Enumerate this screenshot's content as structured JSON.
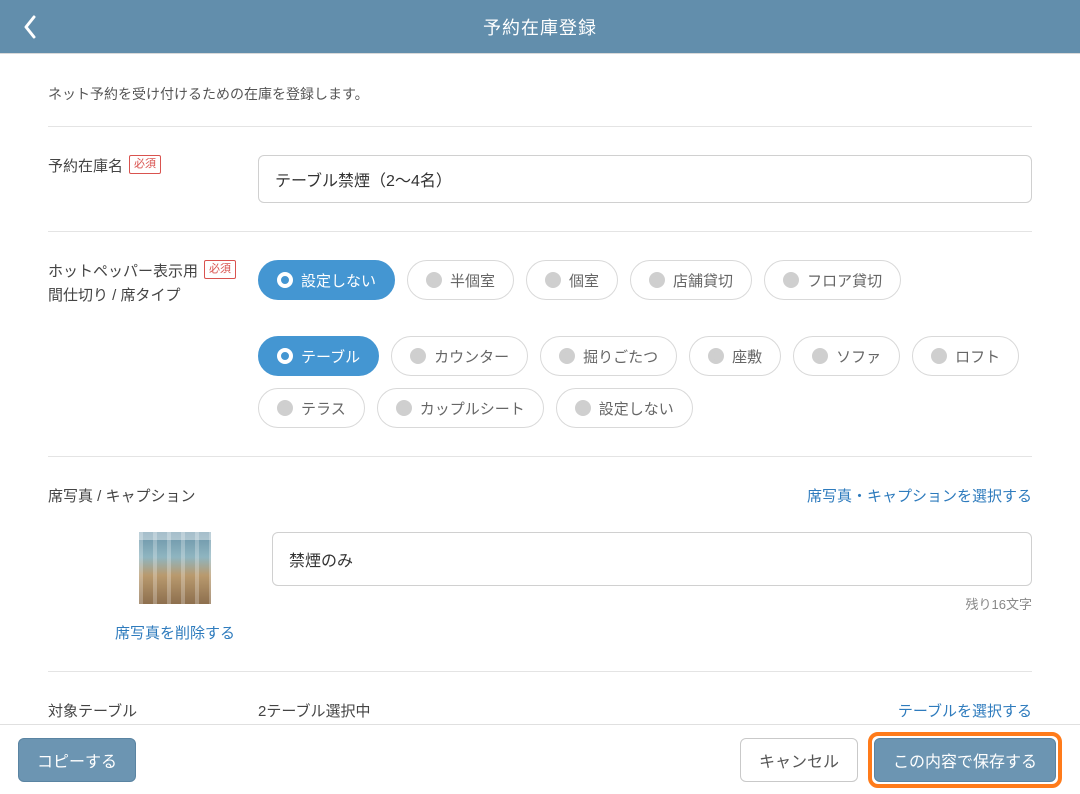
{
  "header": {
    "title": "予約在庫登録"
  },
  "intro": "ネット予約を受け付けるための在庫を登録します。",
  "fields": {
    "inventory_name": {
      "label": "予約在庫名",
      "required_badge": "必須",
      "value": "テーブル禁煙（2〜4名）"
    },
    "partition_seat_type": {
      "label_line1": "ホットペッパー表示用",
      "label_line2": "間仕切り / 席タイプ",
      "required_badge": "必須",
      "group1": {
        "options": [
          "設定しない",
          "半個室",
          "個室",
          "店舗貸切",
          "フロア貸切"
        ],
        "selected_index": 0
      },
      "group2": {
        "options": [
          "テーブル",
          "カウンター",
          "掘りごたつ",
          "座敷",
          "ソファ",
          "ロフト",
          "テラス",
          "カップルシート",
          "設定しない"
        ],
        "selected_index": 0
      }
    },
    "seat_photo": {
      "label": "席写真 / キャプション",
      "select_link": "席写真・キャプションを選択する",
      "delete_link": "席写真を削除する",
      "caption_value": "禁煙のみ",
      "char_left": "残り16文字"
    },
    "target_tables": {
      "label": "対象テーブル",
      "value": "2テーブル選択中",
      "select_link": "テーブルを選択する"
    }
  },
  "footer": {
    "copy": "コピーする",
    "cancel": "キャンセル",
    "save": "この内容で保存する"
  }
}
